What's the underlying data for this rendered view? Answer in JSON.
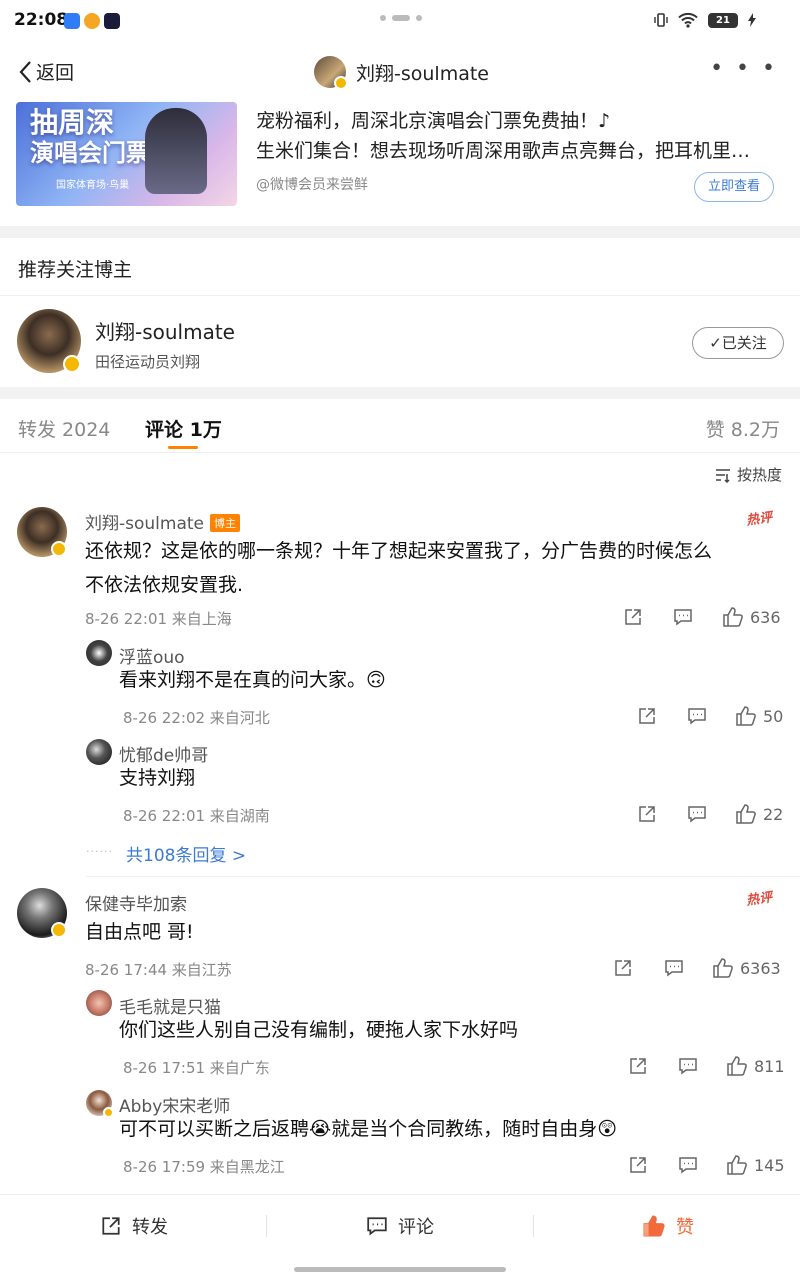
{
  "status_bar": {
    "time": "22:08",
    "battery": "21"
  },
  "nav": {
    "back_label": "返回",
    "title": "刘翔-soulmate",
    "more": "• • •"
  },
  "ad": {
    "image_title_1": "抽周深",
    "image_title_2": "演唱会门票",
    "image_sub": "国家体育场·鸟巢",
    "line1": "宠粉福利，周深北京演唱会门票免费抽！♪",
    "line2": "生米们集合！想去现场听周深用歌声点亮舞台，把耳机里…",
    "source": "@微博会员来尝鲜",
    "button": "立即查看"
  },
  "recommend": {
    "header": "推荐关注博主",
    "name": "刘翔-soulmate",
    "desc": "田径运动员刘翔",
    "follow_label": "已关注"
  },
  "tabs": {
    "repost": "转发 2024",
    "comment": "评论 1万",
    "like": "赞 8.2万"
  },
  "sort_label": "按热度",
  "comments": [
    {
      "name": "刘翔-soulmate",
      "tag": "博主",
      "hot": "热评",
      "text_1": "还依规？这是依的哪一条规？十年了想起来安置我了，分广告费的时候怎么",
      "text_2": "不依法依规安置我.",
      "meta": "8-26 22:01 来自上海",
      "likes": "636",
      "replies": [
        {
          "name": "浮蓝ouo",
          "text": "看来刘翔不是在真的问大家。🙃",
          "meta": "8-26 22:02 来自河北",
          "likes": "50"
        },
        {
          "name": "忧郁de帅哥",
          "text": "支持刘翔",
          "meta": "8-26 22:01 来自湖南",
          "likes": "22"
        }
      ],
      "more_replies": "共108条回复 >"
    },
    {
      "name": "保健寺毕加索",
      "hot": "热评",
      "text_1": "自由点吧 哥!",
      "meta": "8-26 17:44 来自江苏",
      "likes": "6363",
      "replies": [
        {
          "name": "毛毛就是只猫",
          "text": "你们这些人别自己没有编制，硬拖人家下水好吗",
          "meta": "8-26 17:51 来自广东",
          "likes": "811"
        },
        {
          "name": "Abby宋宋老师",
          "text": "可不可以买断之后返聘😭就是当个合同教练，随时自由身😲",
          "meta": "8-26 17:59 来自黑龙江",
          "likes": "145"
        }
      ]
    }
  ],
  "bottom_bar": {
    "repost": "转发",
    "comment": "评论",
    "like": "赞"
  },
  "colors": {
    "accent": "#ff8200",
    "link": "#3b7bd4",
    "like_active": "#f06a3c",
    "hot": "#e24a3b"
  }
}
